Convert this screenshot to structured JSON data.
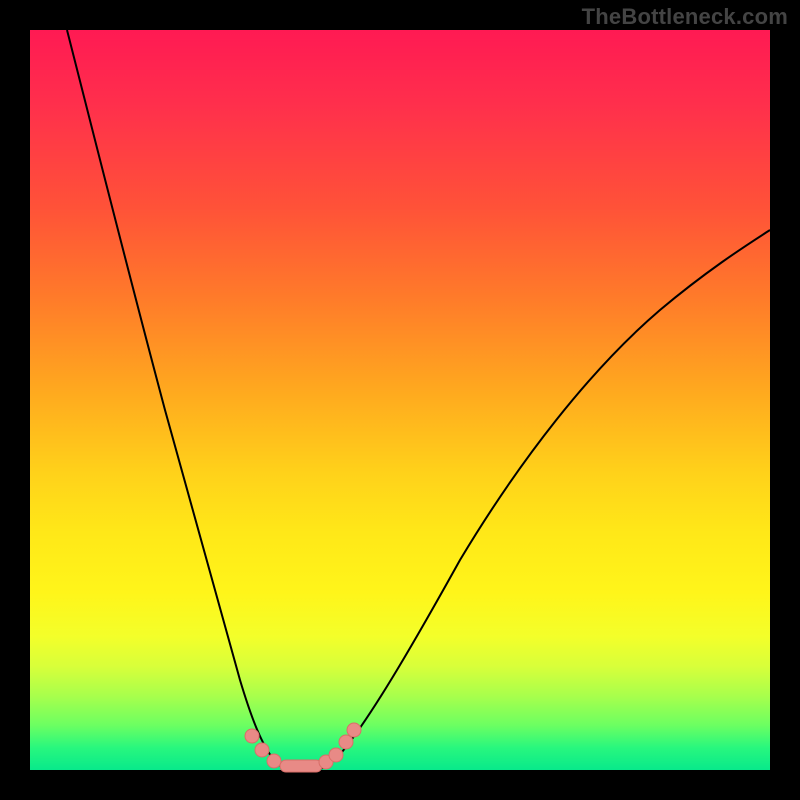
{
  "watermark": "TheBottleneck.com",
  "colors": {
    "frame": "#000000",
    "gradient_top": "#ff1a53",
    "gradient_bottom": "#08e98b",
    "curve": "#000000",
    "marker_fill": "#e88a86",
    "marker_stroke": "#d96e68"
  },
  "chart_data": {
    "type": "line",
    "title": "",
    "xlabel": "",
    "ylabel": "",
    "xlim": [
      0,
      100
    ],
    "ylim": [
      0,
      100
    ],
    "grid": false,
    "legend": false,
    "notes": "Chart has no visible axis ticks, labels, title, or legend. Only a watermark string is rendered. Two black curves form a V-shaped valley over a vertical red→green gradient. Y is read as height within the plot area (100 at top, 0 at bottom). Values are estimated from pixel positions.",
    "series": [
      {
        "name": "left-branch",
        "x": [
          5,
          8,
          12,
          16,
          20,
          24,
          27,
          30,
          32,
          34
        ],
        "y": [
          100,
          84,
          66,
          49,
          34,
          20,
          11,
          5,
          2,
          0
        ]
      },
      {
        "name": "right-branch",
        "x": [
          38,
          41,
          45,
          50,
          56,
          63,
          71,
          80,
          90,
          100
        ],
        "y": [
          0,
          3,
          8,
          16,
          26,
          37,
          48,
          58,
          67,
          74
        ]
      }
    ],
    "markers": {
      "name": "salmon-dots",
      "x": [
        30.0,
        31.5,
        33.0,
        34.5,
        36.0,
        37.5,
        39.0,
        40.5,
        42.0,
        43.5
      ],
      "y": [
        5,
        3,
        1,
        0,
        0,
        0,
        0,
        1,
        2,
        5
      ]
    }
  }
}
